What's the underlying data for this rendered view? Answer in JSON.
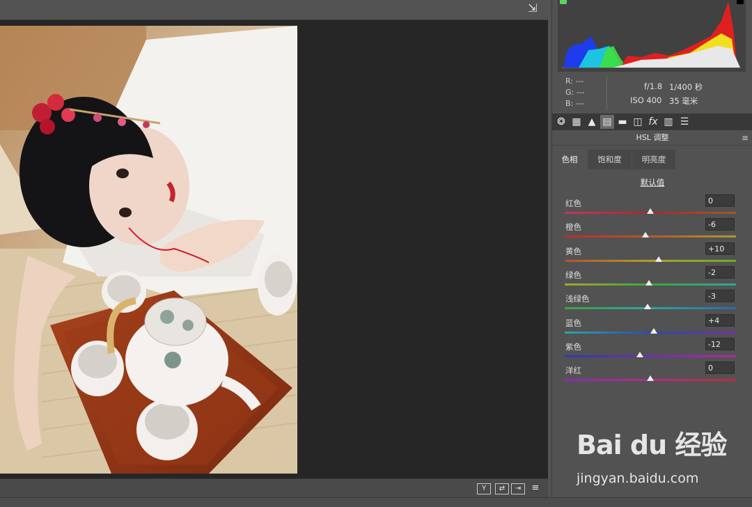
{
  "histogram_info": {
    "r": "R:  ---",
    "g": "G:  ---",
    "b": "B:  ---",
    "aperture": "f/1.8",
    "shutter": "1/400 秒",
    "iso": "ISO 400",
    "focal": "35 毫米"
  },
  "tools": [
    "aperture-icon",
    "tone-curve-icon",
    "mountains-icon",
    "hsl-icon",
    "split-toning-icon",
    "lens-icon",
    "fx-icon",
    "film-icon",
    "sliders-icon"
  ],
  "section": {
    "title": "HSL 调整"
  },
  "tabs": [
    {
      "label": "色相",
      "active": true
    },
    {
      "label": "饱和度",
      "active": false
    },
    {
      "label": "明亮度",
      "active": false
    }
  ],
  "default_label": "默认值",
  "sliders": [
    {
      "label": "红色",
      "value": "0",
      "num": 0,
      "gradient": [
        "#c0395e",
        "#a82a2a",
        "#a8552a"
      ]
    },
    {
      "label": "橙色",
      "value": "-6",
      "num": -6,
      "gradient": [
        "#c02a2a",
        "#b5582a",
        "#b09a2a"
      ]
    },
    {
      "label": "黄色",
      "value": "+10",
      "num": 10,
      "gradient": [
        "#b5502a",
        "#b0a02a",
        "#6ab02a"
      ]
    },
    {
      "label": "绿色",
      "value": "-2",
      "num": -2,
      "gradient": [
        "#a8a82a",
        "#3aa83a",
        "#2aa898"
      ]
    },
    {
      "label": "浅绿色",
      "value": "-3",
      "num": -3,
      "gradient": [
        "#3aa83a",
        "#2aa8a0",
        "#2a6ab0"
      ]
    },
    {
      "label": "蓝色",
      "value": "+4",
      "num": 4,
      "gradient": [
        "#2aa8a0",
        "#2a4ab8",
        "#7a2ab0"
      ]
    },
    {
      "label": "紫色",
      "value": "-12",
      "num": -12,
      "gradient": [
        "#2a3ab8",
        "#7a2ab8",
        "#b02aa0"
      ]
    },
    {
      "label": "洋红",
      "value": "0",
      "num": 0,
      "gradient": [
        "#8a2ab8",
        "#b82a8a",
        "#c02a3a"
      ]
    }
  ],
  "bottom_buttons": [
    "Y",
    "⇄",
    "⇥",
    "≡"
  ],
  "watermark": {
    "logo": "Bai du 经验",
    "url": "jingyan.baidu.com"
  }
}
